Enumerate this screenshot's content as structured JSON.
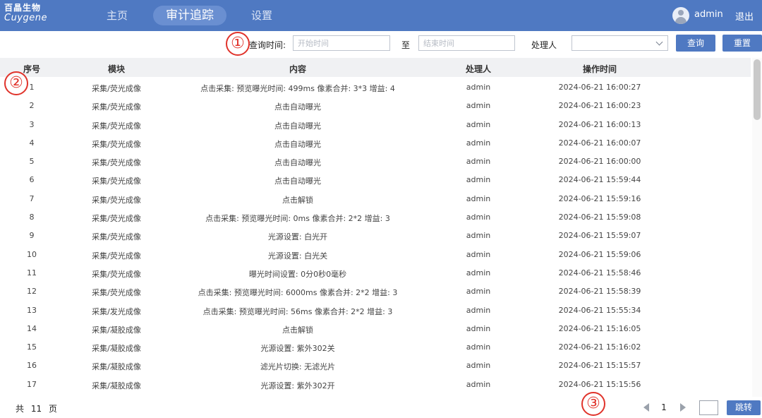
{
  "header": {
    "logo": {
      "line1": "百晶生物",
      "line2": "Cuygene"
    },
    "nav": [
      {
        "label": "主页",
        "active": false
      },
      {
        "label": "审计追踪",
        "active": true
      },
      {
        "label": "设置",
        "active": false
      }
    ],
    "avatar_icon": "user-avatar-icon",
    "user": "admin",
    "logout": "退出"
  },
  "filters": {
    "query_time_label": "查询时间:",
    "start_placeholder": "开始时间",
    "to_label": "至",
    "end_placeholder": "结束时间",
    "handler_label": "处理人",
    "handler_value": "",
    "query_button": "查询",
    "reset_button": "重置"
  },
  "annotations": [
    "①",
    "②",
    "③"
  ],
  "table": {
    "columns": [
      "序号",
      "模块",
      "内容",
      "处理人",
      "操作时间"
    ],
    "rows": [
      [
        "1",
        "采集/荧光成像",
        "点击采集: 预览曝光时间: 499ms 像素合并: 3*3 增益: 4",
        "admin",
        "2024-06-21 16:00:27"
      ],
      [
        "2",
        "采集/荧光成像",
        "点击自动曝光",
        "admin",
        "2024-06-21 16:00:23"
      ],
      [
        "3",
        "采集/荧光成像",
        "点击自动曝光",
        "admin",
        "2024-06-21 16:00:13"
      ],
      [
        "4",
        "采集/荧光成像",
        "点击自动曝光",
        "admin",
        "2024-06-21 16:00:07"
      ],
      [
        "5",
        "采集/荧光成像",
        "点击自动曝光",
        "admin",
        "2024-06-21 16:00:00"
      ],
      [
        "6",
        "采集/荧光成像",
        "点击自动曝光",
        "admin",
        "2024-06-21 15:59:44"
      ],
      [
        "7",
        "采集/荧光成像",
        "点击解锁",
        "admin",
        "2024-06-21 15:59:16"
      ],
      [
        "8",
        "采集/荧光成像",
        "点击采集: 预览曝光时间: 0ms 像素合并: 2*2 增益: 3",
        "admin",
        "2024-06-21 15:59:08"
      ],
      [
        "9",
        "采集/荧光成像",
        "光源设置: 白光开",
        "admin",
        "2024-06-21 15:59:07"
      ],
      [
        "10",
        "采集/荧光成像",
        "光源设置: 白光关",
        "admin",
        "2024-06-21 15:59:06"
      ],
      [
        "11",
        "采集/荧光成像",
        "曝光时间设置: 0分0秒0毫秒",
        "admin",
        "2024-06-21 15:58:46"
      ],
      [
        "12",
        "采集/荧光成像",
        "点击采集: 预览曝光时间: 6000ms 像素合并: 2*2 增益: 3",
        "admin",
        "2024-06-21 15:58:39"
      ],
      [
        "13",
        "采集/发光成像",
        "点击采集: 预览曝光时间: 56ms 像素合并: 2*2 增益: 3",
        "admin",
        "2024-06-21 15:55:34"
      ],
      [
        "14",
        "采集/凝胶成像",
        "点击解锁",
        "admin",
        "2024-06-21 15:16:05"
      ],
      [
        "15",
        "采集/凝胶成像",
        "光源设置: 紫外302关",
        "admin",
        "2024-06-21 15:16:02"
      ],
      [
        "16",
        "采集/凝胶成像",
        "滤光片切换: 无滤光片",
        "admin",
        "2024-06-21 15:15:57"
      ],
      [
        "17",
        "采集/凝胶成像",
        "光源设置: 紫外302开",
        "admin",
        "2024-06-21 15:15:56"
      ]
    ]
  },
  "pagination": {
    "total_prefix": "共",
    "total_pages": "11",
    "total_suffix": "页",
    "current_page": "1",
    "jump_value": "",
    "jump_button": "跳转"
  },
  "colors": {
    "header_bg": "#4f79c2",
    "button_bg": "#4f79c2",
    "annotation": "#e0332b"
  }
}
